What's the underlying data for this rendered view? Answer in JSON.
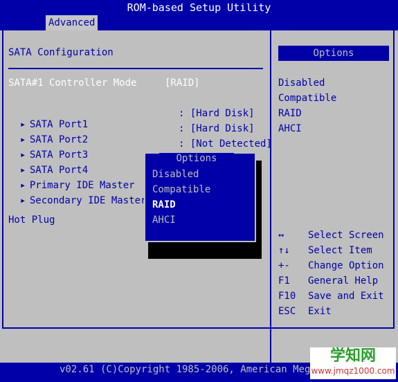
{
  "title": "ROM-based Setup Utility",
  "menu": {
    "active_tab": "Advanced"
  },
  "section": {
    "title": "SATA Configuration"
  },
  "controller": {
    "label": "SATA#1 Controller Mode",
    "value": "[RAID]"
  },
  "items": [
    {
      "label": "SATA Port1",
      "value": ": [Hard Disk]"
    },
    {
      "label": "SATA Port2",
      "value": ": [Hard Disk]"
    },
    {
      "label": "SATA Port3",
      "value": ": [Not Detected]"
    },
    {
      "label": "SATA Port4",
      "value": ""
    },
    {
      "label": "Primary IDE Master",
      "value": ""
    },
    {
      "label": "Secondary IDE Master",
      "value": ""
    }
  ],
  "hot_plug": {
    "label": "Hot Plug"
  },
  "help_panel": {
    "header": "Options",
    "options": [
      "Disabled",
      "Compatible",
      "RAID",
      "AHCI"
    ]
  },
  "keys": [
    {
      "key": "↔",
      "desc": "Select Screen"
    },
    {
      "key": "↑↓",
      "desc": "Select Item"
    },
    {
      "key": "+-",
      "desc": "Change Option"
    },
    {
      "key": "F1",
      "desc": "General Help"
    },
    {
      "key": "F10",
      "desc": "Save and Exit"
    },
    {
      "key": "ESC",
      "desc": "Exit"
    }
  ],
  "popup": {
    "title": "Options",
    "options": [
      "Disabled",
      "Compatible",
      "RAID",
      "AHCI"
    ],
    "selected": "RAID"
  },
  "footer": "v02.61 (C)Copyright 1985-2006, American Megatrends, Inc.",
  "watermark": {
    "big": "学知网",
    "small": "www.jmqz1000.com"
  },
  "colors": {
    "blue": "#0000a8",
    "grey": "#bfbfbf",
    "white": "#ffffff"
  }
}
